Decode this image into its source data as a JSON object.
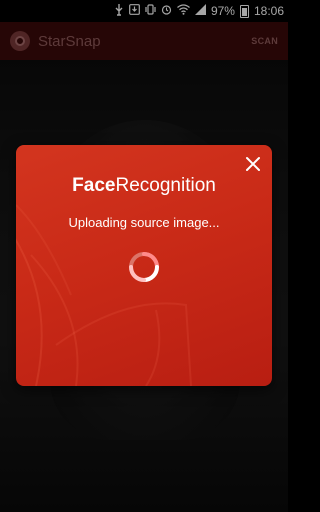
{
  "status_bar": {
    "battery_percent": "97%",
    "time": "18:06"
  },
  "app_bar": {
    "title": "StarSnap",
    "scan_label": "SCAN"
  },
  "dialog": {
    "title_bold": "Face",
    "title_regular": "Recognition",
    "status_text": "Uploading source image...",
    "close_icon": "close-icon",
    "accent_color": "#c92a17"
  }
}
